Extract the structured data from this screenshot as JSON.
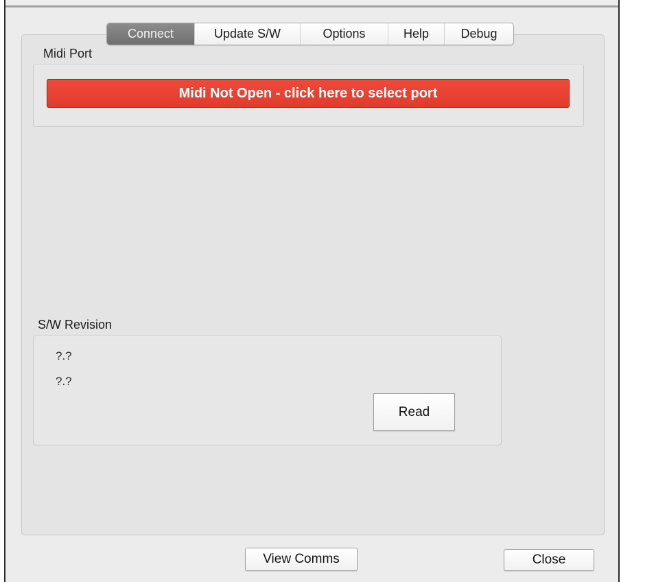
{
  "tabs": [
    {
      "label": "Connect",
      "active": true
    },
    {
      "label": "Update S/W",
      "active": false
    },
    {
      "label": "Options",
      "active": false
    },
    {
      "label": "Help",
      "active": false
    },
    {
      "label": "Debug",
      "active": false
    }
  ],
  "midi_port": {
    "group_label": "Midi Port",
    "button_label": "Midi Not Open - click here to select port",
    "button_color": "#e8412f"
  },
  "sw_revision": {
    "group_label": "S/W Revision",
    "values": [
      "?.?",
      "?.?"
    ],
    "read_label": "Read"
  },
  "footer": {
    "view_comms_label": "View Comms",
    "close_label": "Close"
  },
  "colors": {
    "active_tab": "#7d7d7d",
    "window_bg": "#ececec",
    "panel_bg": "#e4e4e4"
  }
}
